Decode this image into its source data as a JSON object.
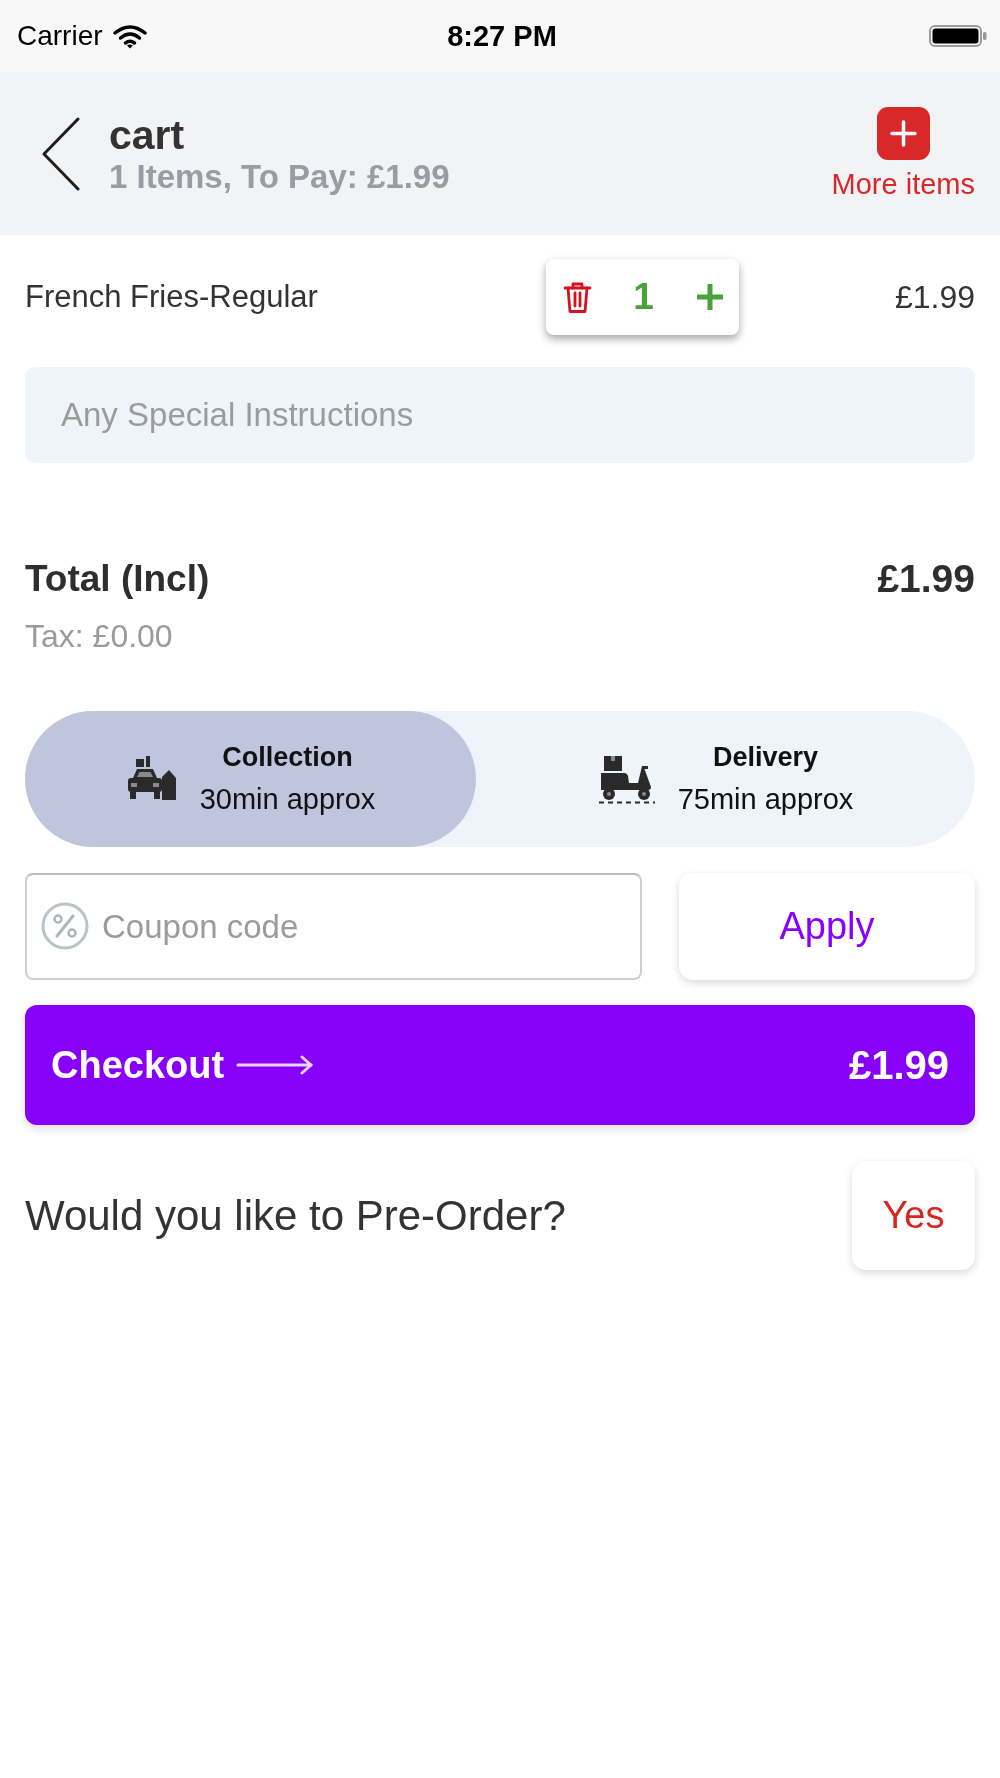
{
  "status_bar": {
    "carrier": "Carrier",
    "time": "8:27 PM"
  },
  "header": {
    "title": "cart",
    "subtitle": "1 Items, To Pay: £1.99",
    "more_items_label": "More items"
  },
  "cart_items": [
    {
      "name": "French Fries-Regular",
      "quantity": "1",
      "price": "£1.99"
    }
  ],
  "instructions": {
    "placeholder": "Any Special Instructions"
  },
  "total": {
    "label": "Total (Incl)",
    "amount": "£1.99",
    "tax": "Tax: £0.00"
  },
  "fulfilment_options": [
    {
      "kind": "collection",
      "title": "Collection",
      "eta": "30min approx",
      "selected": true
    },
    {
      "kind": "delivery",
      "title": "Delivery",
      "eta": "75min approx",
      "selected": false
    }
  ],
  "coupon": {
    "placeholder": "Coupon code",
    "apply_label": "Apply"
  },
  "checkout": {
    "label": "Checkout",
    "amount": "£1.99"
  },
  "pre_order": {
    "question": "Would you like to Pre-Order?",
    "answer_label": "Yes"
  }
}
